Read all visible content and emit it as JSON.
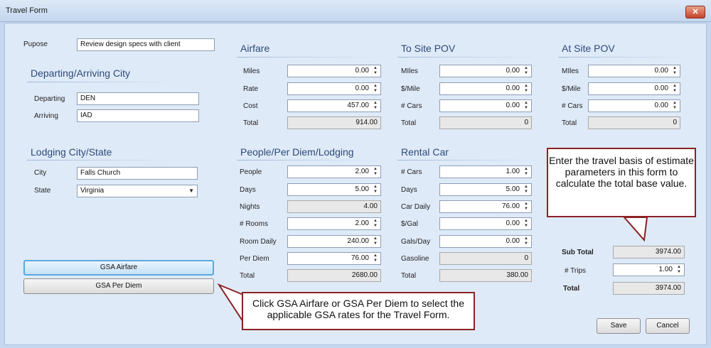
{
  "window": {
    "title": "Travel Form",
    "close_glyph": "✕"
  },
  "purpose": {
    "label": "Pupose",
    "value": "Review design specs with client"
  },
  "departing_arriving": {
    "heading": "Departing/Arriving City",
    "departing_label": "Departing",
    "departing_value": "DEN",
    "arriving_label": "Arriving",
    "arriving_value": "IAD"
  },
  "lodging": {
    "heading": "Lodging City/State",
    "city_label": "City",
    "city_value": "Falls Church",
    "state_label": "State",
    "state_value": "Virginia"
  },
  "airfare": {
    "heading": "Airfare",
    "miles_label": "Miles",
    "miles_value": "0.00",
    "rate_label": "Rate",
    "rate_value": "0.00",
    "cost_label": "Cost",
    "cost_value": "457.00",
    "total_label": "Total",
    "total_value": "914.00"
  },
  "to_site_pov": {
    "heading": "To Site POV",
    "miles_label": "MIles",
    "miles_value": "0.00",
    "per_mile_label": "$/Mile",
    "per_mile_value": "0.00",
    "cars_label": "# Cars",
    "cars_value": "0.00",
    "total_label": "Total",
    "total_value": "0"
  },
  "at_site_pov": {
    "heading": "At Site POV",
    "miles_label": "MIles",
    "miles_value": "0.00",
    "per_mile_label": "$/Mile",
    "per_mile_value": "0.00",
    "cars_label": "# Cars",
    "cars_value": "0.00",
    "total_label": "Total",
    "total_value": "0"
  },
  "people_per_diem": {
    "heading": "People/Per Diem/Lodging",
    "people_label": "People",
    "people_value": "2.00",
    "days_label": "Days",
    "days_value": "5.00",
    "nights_label": "Nights",
    "nights_value": "4.00",
    "rooms_label": "# Rooms",
    "rooms_value": "2.00",
    "room_daily_label": "Room Daily",
    "room_daily_value": "240.00",
    "per_diem_label": "Per Diem",
    "per_diem_value": "76.00",
    "total_label": "Total",
    "total_value": "2680.00"
  },
  "rental_car": {
    "heading": "Rental Car",
    "cars_label": "# Cars",
    "cars_value": "1.00",
    "days_label": "Days",
    "days_value": "5.00",
    "car_daily_label": "Car Daily",
    "car_daily_value": "76.00",
    "per_gal_label": "$/Gal",
    "per_gal_value": "0.00",
    "gals_day_label": "Gals/Day",
    "gals_day_value": "0.00",
    "gasoline_label": "Gasoline",
    "gasoline_value": "0",
    "total_label": "Total",
    "total_value": "380.00"
  },
  "summary": {
    "subtotal_label": "Sub Total",
    "subtotal_value": "3974.00",
    "trips_label": "# Trips",
    "trips_value": "1.00",
    "total_label": "Total",
    "total_value": "3974.00"
  },
  "buttons": {
    "gsa_airfare": "GSA Airfare",
    "gsa_per_diem": "GSA Per Diem",
    "save": "Save",
    "cancel": "Cancel"
  },
  "callouts": {
    "travel_basis": "Enter the travel basis of estimate parameters in this form to calculate the total base value.",
    "gsa": "Click GSA Airfare or GSA Per Diem to select the applicable GSA rates for the Travel Form."
  },
  "icons": {
    "spinner": "spinner-updown-icon",
    "dropdown": "chevron-down-icon"
  },
  "colors": {
    "heading": "#2d4a78",
    "callout_border": "#8b2222",
    "focus_border": "#5aa8de"
  }
}
